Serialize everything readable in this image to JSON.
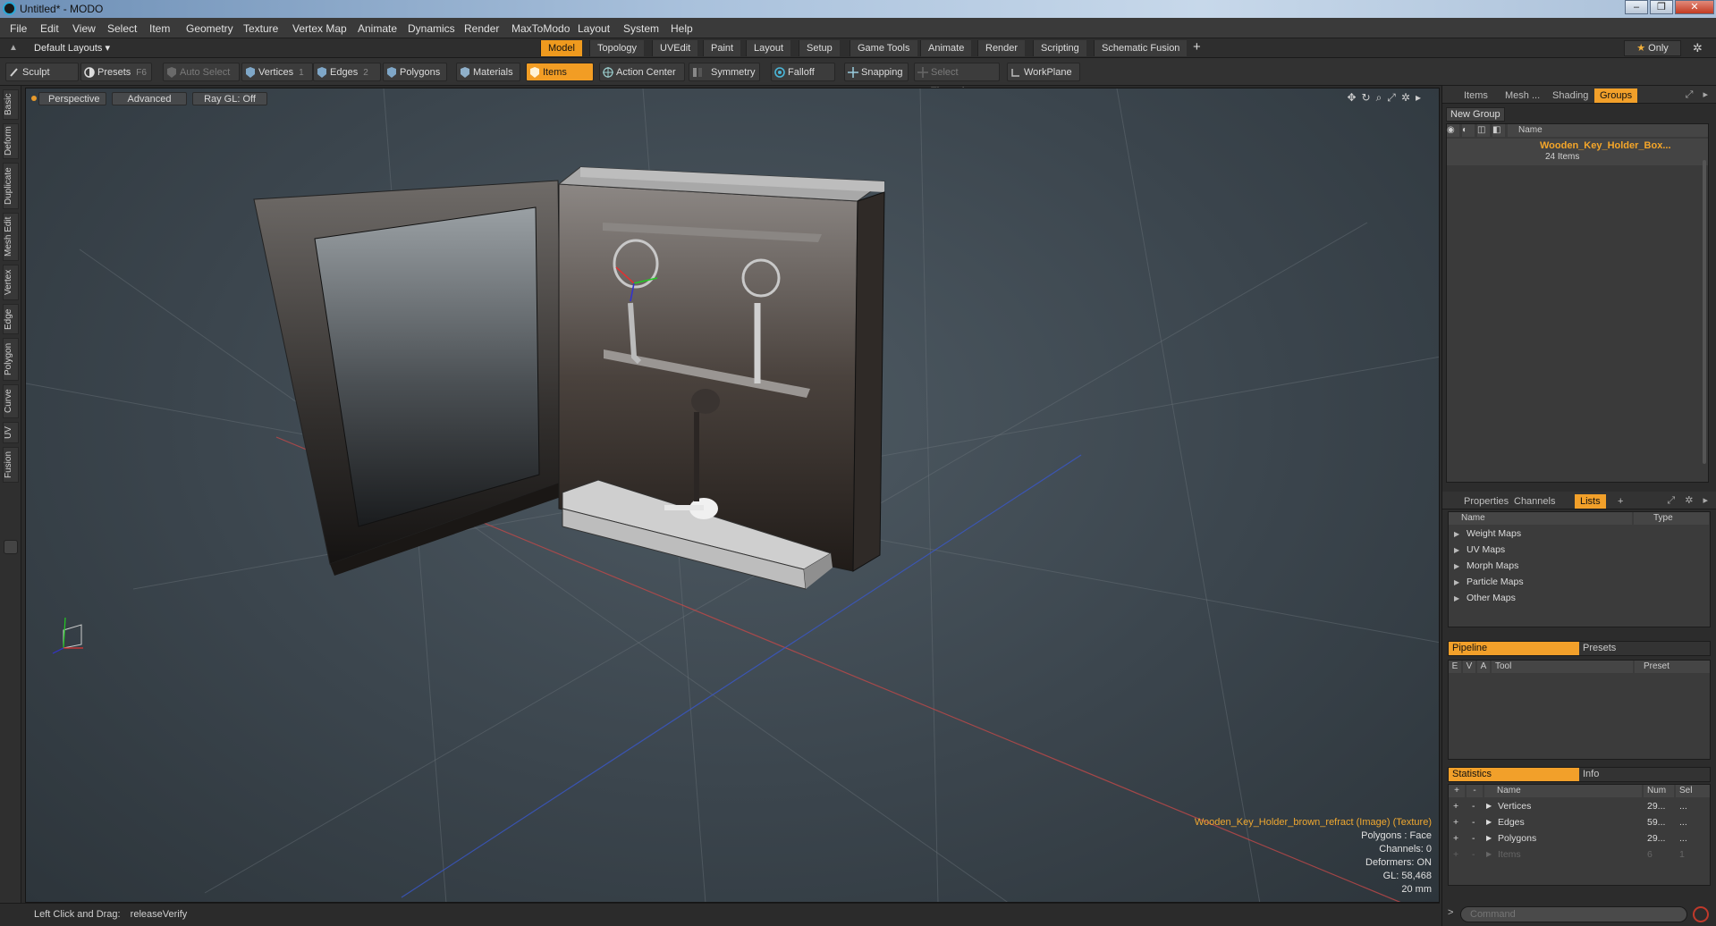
{
  "window": {
    "title": "Untitled* - MODO",
    "controls": [
      "–",
      "❐",
      "✕"
    ]
  },
  "menubar": [
    "File",
    "Edit",
    "View",
    "Select",
    "Item",
    "Geometry",
    "Texture",
    "Vertex Map",
    "Animate",
    "Dynamics",
    "Render",
    "MaxToModo",
    "Layout",
    "System",
    "Help"
  ],
  "layout_bar": {
    "preset": "Default Layouts ▾",
    "tabs": [
      "Model",
      "Topology",
      "UVEdit",
      "Paint",
      "Layout",
      "Setup",
      "Game Tools",
      "Animate",
      "Render",
      "Scripting",
      "Schematic Fusion"
    ],
    "active_tab": "Model",
    "add": "+",
    "only_label": "Only",
    "only_icon": "star-icon",
    "settings_icon": "gear-icon"
  },
  "toolbar": {
    "sculpt": "Sculpt",
    "presets": "Presets",
    "presets_key": "F6",
    "auto_select": "Auto Select",
    "vertices": "Vertices",
    "vertices_key": "1",
    "edges": "Edges",
    "edges_key": "2",
    "polygons": "Polygons",
    "materials": "Materials",
    "items": "Items",
    "action_center": "Action Center",
    "symmetry": "Symmetry",
    "falloff": "Falloff",
    "snapping": "Snapping",
    "select_through": "Select Through",
    "workplane": "WorkPlane"
  },
  "left_tabs": [
    "Basic",
    "Deform",
    "Duplicate",
    "Mesh Edit",
    "Vertex",
    "Edge",
    "Polygon",
    "Curve",
    "UV",
    "Fusion"
  ],
  "viewport": {
    "view_mode": "Perspective",
    "shading": "Advanced",
    "raygl": "Ray GL: Off",
    "info": {
      "texture": "Wooden_Key_Holder_brown_refract (Image) (Texture)",
      "polygons": "Polygons : Face",
      "channels": "Channels: 0",
      "deformers": "Deformers: ON",
      "gl": "GL: 58,468",
      "scale": "20 mm"
    }
  },
  "statusbar": {
    "hint": "Left Click and Drag:",
    "command": "releaseVerify"
  },
  "top_panel": {
    "tabs": [
      "Items",
      "Mesh ...",
      "Shading",
      "Groups"
    ],
    "active_tab": "Groups",
    "new_group": "New Group",
    "name_col": "Name",
    "group": {
      "name": "Wooden_Key_Holder_Box...",
      "count": "24 Items"
    }
  },
  "mid_panel": {
    "tabs": [
      "Properties",
      "Channels",
      "Lists"
    ],
    "active_tab": "Lists",
    "add": "+",
    "col_name": "Name",
    "col_type": "Type",
    "rows": [
      "Weight Maps",
      "UV Maps",
      "Morph Maps",
      "Particle Maps",
      "Other Maps"
    ]
  },
  "pipeline": {
    "tabs": [
      "Pipeline",
      "Presets"
    ],
    "cols": [
      "E",
      "V",
      "A",
      "Tool",
      "Preset"
    ]
  },
  "stats": {
    "tabs": [
      "Statistics",
      "Info"
    ],
    "cols": [
      "+",
      "-",
      "Name",
      "Num",
      "Sel"
    ],
    "rows": [
      {
        "name": "Vertices",
        "num": "29...",
        "sel": "..."
      },
      {
        "name": "Edges",
        "num": "59...",
        "sel": "..."
      },
      {
        "name": "Polygons",
        "num": "29...",
        "sel": "..."
      },
      {
        "name": "Items",
        "num": "6",
        "sel": "1"
      }
    ]
  },
  "command_field": {
    "placeholder": "Command"
  },
  "colors": {
    "accent": "#f29d24",
    "group_name": "#f5a629"
  }
}
